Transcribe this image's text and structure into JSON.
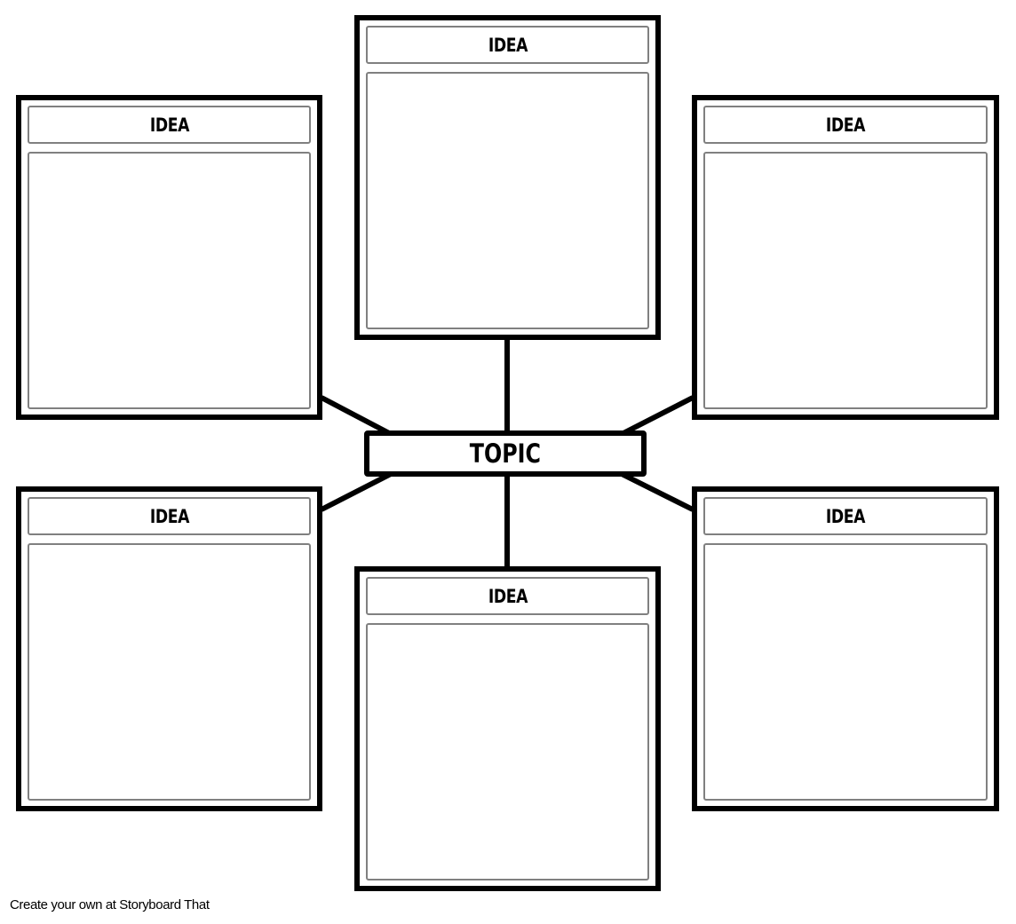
{
  "diagram": {
    "type": "spider-map",
    "center": {
      "label": "TOPIC"
    },
    "ideas": [
      {
        "position": "top-center",
        "title": "IDEA",
        "content": ""
      },
      {
        "position": "upper-left",
        "title": "IDEA",
        "content": ""
      },
      {
        "position": "upper-right",
        "title": "IDEA",
        "content": ""
      },
      {
        "position": "lower-left",
        "title": "IDEA",
        "content": ""
      },
      {
        "position": "bottom-center",
        "title": "IDEA",
        "content": ""
      },
      {
        "position": "lower-right",
        "title": "IDEA",
        "content": ""
      }
    ],
    "colors": {
      "border": "#000000",
      "inner_border": "#808080",
      "background": "#ffffff"
    }
  },
  "footer": {
    "text": "Create your own at Storyboard That"
  }
}
